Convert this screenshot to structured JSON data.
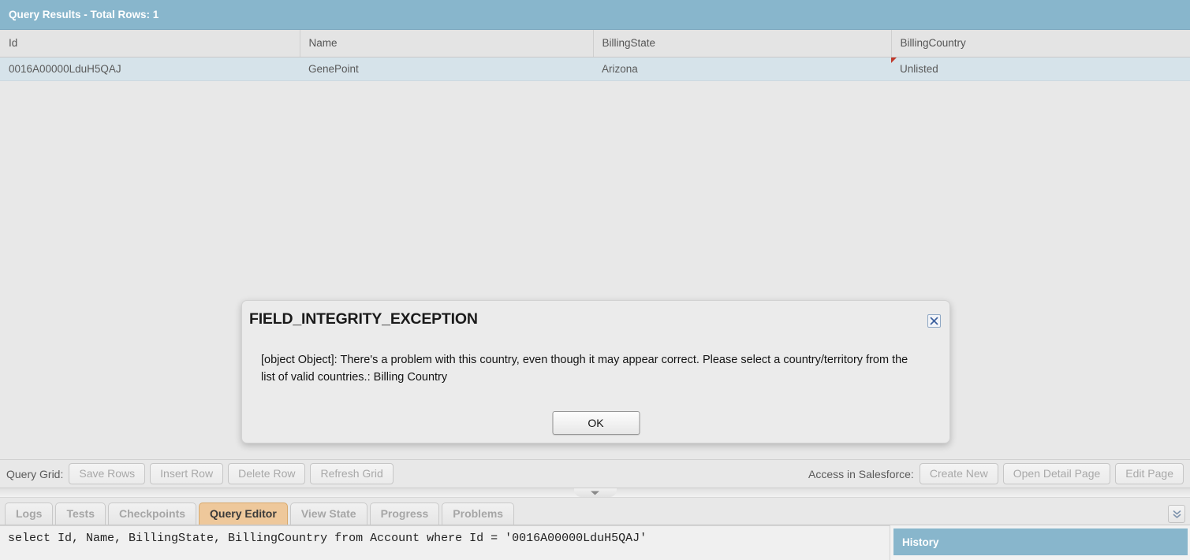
{
  "results": {
    "header_title": "Query Results - Total Rows: 1",
    "columns": [
      "Id",
      "Name",
      "BillingState",
      "BillingCountry"
    ],
    "rows": [
      {
        "Id": "0016A00000LduH5QAJ",
        "Name": "GenePoint",
        "BillingState": "Arizona",
        "BillingCountry": "Unlisted"
      }
    ],
    "flagged_cell": "BillingCountry",
    "flag_color": "#c0392b",
    "header_color": "#88b6cc",
    "row_color": "#d6e3ea"
  },
  "dialog": {
    "title": "FIELD_INTEGRITY_EXCEPTION",
    "message": "[object Object]: There's a problem with this country, even though it may appear correct. Please select a country/territory from the list of valid countries.: Billing Country",
    "ok_label": "OK",
    "close_icon": "close-x-icon"
  },
  "grid_toolbar": {
    "label": "Query Grid:",
    "buttons": [
      "Save Rows",
      "Insert Row",
      "Delete Row",
      "Refresh Grid"
    ],
    "right_label": "Access in Salesforce:",
    "right_buttons": [
      "Create New",
      "Open Detail Page",
      "Edit Page"
    ]
  },
  "splitter": {
    "handle_icon": "chevron-down-icon"
  },
  "tabs": {
    "items": [
      {
        "label": "Logs",
        "active": false
      },
      {
        "label": "Tests",
        "active": false
      },
      {
        "label": "Checkpoints",
        "active": false
      },
      {
        "label": "Query Editor",
        "active": true
      },
      {
        "label": "View State",
        "active": false
      },
      {
        "label": "Progress",
        "active": false
      },
      {
        "label": "Problems",
        "active": false
      }
    ],
    "active_color": "#eec89b",
    "overflow_icon": "double-chevron-down-icon"
  },
  "editor": {
    "query": "select Id, Name, BillingState, BillingCountry from Account where Id = '0016A00000LduH5QAJ'"
  },
  "history": {
    "title": "History"
  }
}
